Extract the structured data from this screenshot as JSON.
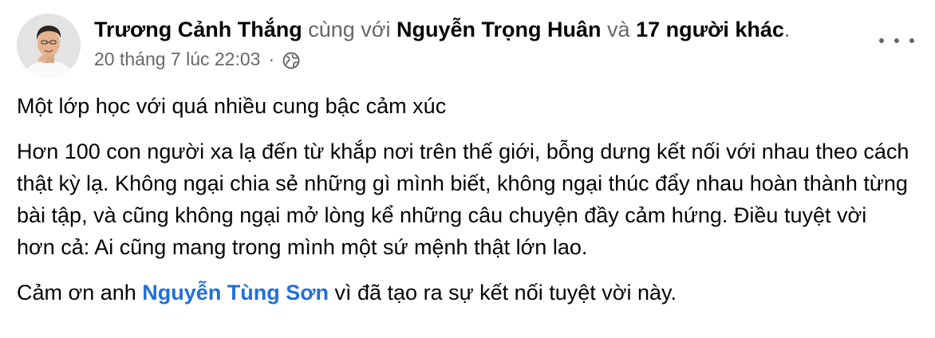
{
  "post": {
    "author": "Trương Cảnh Thắng",
    "with_text": "cùng với",
    "tagged_person": "Nguyễn Trọng Huân",
    "and_text": "và",
    "others_text": "17 người khác",
    "header_end": ".",
    "timestamp": "20 tháng 7 lúc 22:03",
    "separator": "·",
    "privacy_icon": "globe-icon",
    "menu_icon": "more-options-icon",
    "paragraph1": "Một lớp học với quá nhiều cung bậc cảm xúc",
    "paragraph2": "Hơn 100 con người xa lạ đến từ khắp nơi trên thế giới, bỗng dưng kết nối với nhau theo cách thật kỳ lạ. Không ngại chia sẻ những gì mình biết, không ngại thúc đẩy nhau hoàn thành từng bài tập, và cũng không ngại mở lòng kể những câu chuyện đầy cảm hứng. Điều tuyệt vời hơn cả: Ai cũng mang trong mình một sứ mệnh thật lớn lao.",
    "paragraph3_prefix": "Cảm ơn anh",
    "paragraph3_mention": "Nguyễn Tùng Sơn",
    "paragraph3_suffix": "vì đã tạo ra sự kết nối tuyệt vời này.",
    "colors": {
      "text": "#050505",
      "secondary": "#65676b",
      "link": "#216fdb"
    }
  }
}
